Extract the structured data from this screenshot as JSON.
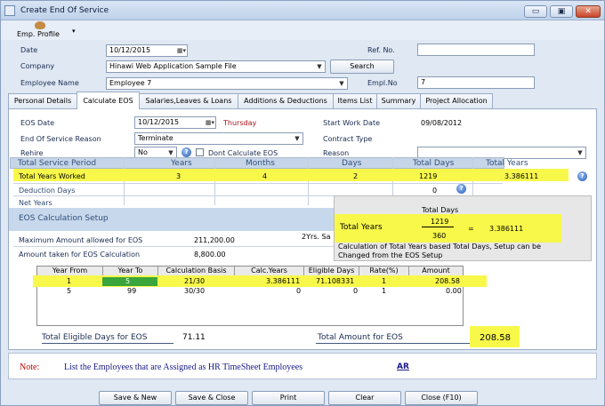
{
  "window": {
    "title": "Create End Of Service",
    "minimize": "▭",
    "restore": "▣",
    "close": "✕"
  },
  "toolbar": {
    "emp_profile": "Emp. Profile"
  },
  "header": {
    "date_label": "Date",
    "date_value": "10/12/2015",
    "company_label": "Company",
    "company_value": "Hinawi Web Application Sample File",
    "employee_label": "Employee Name",
    "employee_value": "Employee 7",
    "ref_label": "Ref. No.",
    "ref_value": "",
    "search_button": "Search",
    "emplno_label": "Empl.No",
    "emplno_value": "7"
  },
  "tabs": [
    "Personal Details",
    "Calculate EOS",
    "Salaries,Leaves & Loans",
    "Additions & Deductions",
    "Items List",
    "Summary",
    "Project Allocation"
  ],
  "eos": {
    "eos_date_label": "EOS Date",
    "eos_date_value": "10/12/2015",
    "eos_day": "Thursday",
    "reason_label": "End Of Service Reason",
    "reason_value": "Terminate",
    "rehire_label": "Rehire",
    "rehire_value": "No",
    "dont_calc_label": "Dont Calculate EOS",
    "start_work_label": "Start Work Date",
    "start_work_value": "09/08/2012",
    "contract_type_label": "Contract Type",
    "reason2_label": "Reason",
    "reason2_value": ""
  },
  "service_grid": {
    "headers": [
      "Total Service Period",
      "Years",
      "Months",
      "Days",
      "Total Days",
      "Total Years"
    ],
    "rows": [
      {
        "label": "Total Years Worked",
        "years": "3",
        "months": "4",
        "days": "2",
        "total_days": "1219",
        "total_years": "3.386111"
      },
      {
        "label": "Deduction Days",
        "total_days": "0"
      },
      {
        "label": "Net Years"
      }
    ]
  },
  "tooltip": {
    "title": "Total Days",
    "label": "Total Years",
    "numerator": "1219",
    "denominator": "360",
    "equals": "=",
    "result": "3.386111",
    "desc1": "Calculation of Total Years based Total  Days, Setup can be",
    "desc2": "Changed from the EOS Setup"
  },
  "setup": {
    "title": "EOS Calculation Setup",
    "max_label": "Maximum Amount allowed for EOS",
    "max_value": "211,200.00",
    "taken_label": "Amount taken for EOS Calculation",
    "taken_value": "8,800.00",
    "side_text": "2Yrs. Sa"
  },
  "calc_table": {
    "headers": [
      "Year From",
      "Year To",
      "Calculation Basis",
      "Calc.Years",
      "Eligible Days",
      "Rate(%)",
      "Amount"
    ],
    "rows": [
      [
        "1",
        "5",
        "21/30",
        "3.386111",
        "71.108331",
        "1",
        "208.58"
      ],
      [
        "5",
        "99",
        "30/30",
        "0",
        "0",
        "1",
        "0.00"
      ]
    ]
  },
  "totals": {
    "eligible_label": "Total Eligible Days for EOS",
    "eligible_value": "71.11",
    "amount_label": "Total Amount for EOS",
    "amount_value": "208.58"
  },
  "note": {
    "label": "Note:",
    "text": "List the Employees that are Assigned as HR  TimeSheet Employees",
    "link": "AR"
  },
  "buttons": {
    "save_new": "Save & New",
    "save_close": "Save & Close",
    "print": "Print",
    "clear": "Clear",
    "close": "Close (F10)"
  },
  "colors": {
    "highlight": "#f8f84a",
    "grid_header": "#c7d5e8",
    "year_to_cell": "#3aa53a",
    "note_red": "#c00000",
    "note_blue": "#1a1a8a"
  }
}
